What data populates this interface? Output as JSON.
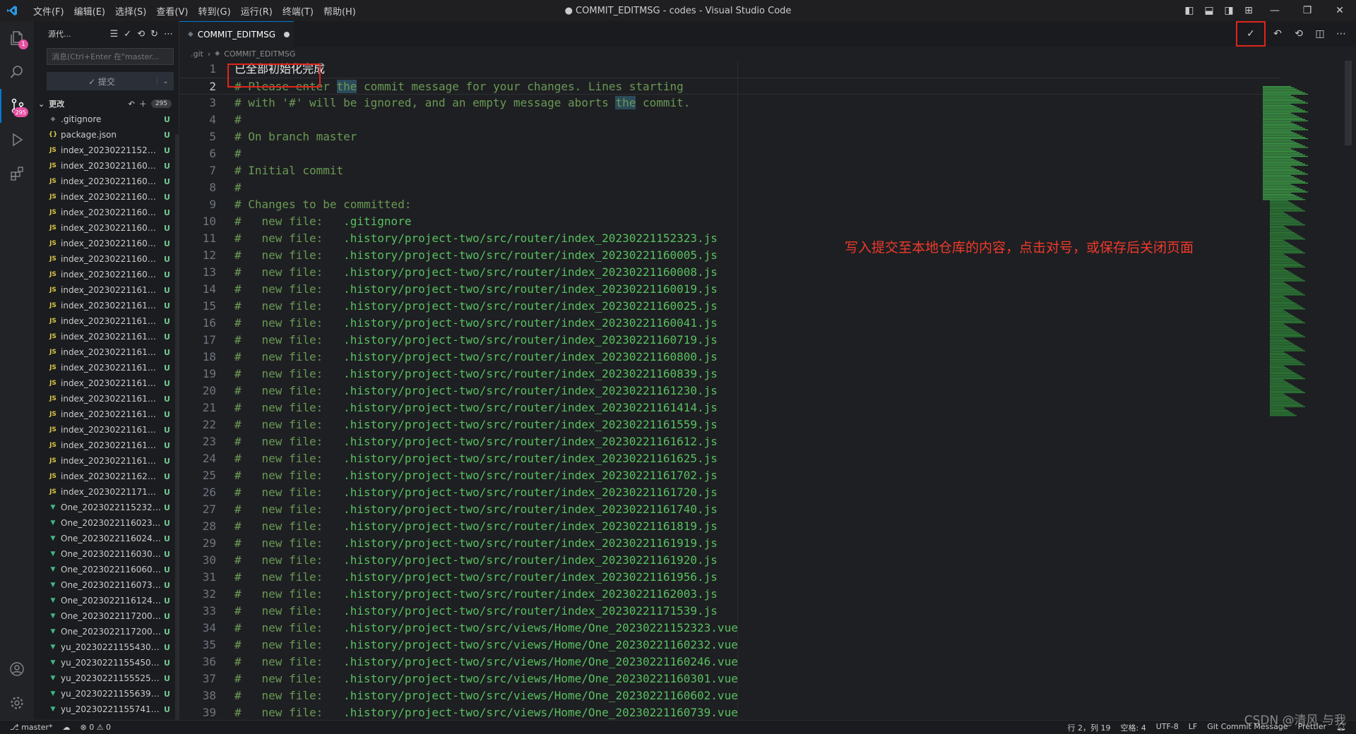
{
  "titlebar": {
    "menu": [
      "文件(F)",
      "编辑(E)",
      "选择(S)",
      "查看(V)",
      "转到(G)",
      "运行(R)",
      "终端(T)",
      "帮助(H)"
    ],
    "window_title": "● COMMIT_EDITMSG - codes - Visual Studio Code"
  },
  "activity": {
    "badge": "1"
  },
  "sidebar": {
    "title": "源代...",
    "commit_placeholder": "消息(Ctrl+Enter 在\"master...",
    "commit_button": "✓ 提交",
    "changes_label": "更改",
    "changes_count": "295",
    "files": [
      {
        "icon": "◆",
        "type": "git",
        "name": ".gitignore",
        "status": "U"
      },
      {
        "icon": "{}",
        "type": "json",
        "name": "package.json",
        "status": "U"
      },
      {
        "icon": "JS",
        "type": "js",
        "name": "index_2023022115232...",
        "status": "U"
      },
      {
        "icon": "JS",
        "type": "js",
        "name": "index_20230221160000...",
        "status": "U"
      },
      {
        "icon": "JS",
        "type": "js",
        "name": "index_20230221160000...",
        "status": "U"
      },
      {
        "icon": "JS",
        "type": "js",
        "name": "index_20230221160001...",
        "status": "U"
      },
      {
        "icon": "JS",
        "type": "js",
        "name": "index_20230221160002...",
        "status": "U"
      },
      {
        "icon": "JS",
        "type": "js",
        "name": "index_20230221160004...",
        "status": "U"
      },
      {
        "icon": "JS",
        "type": "js",
        "name": "index_2023022116071...",
        "status": "U"
      },
      {
        "icon": "JS",
        "type": "js",
        "name": "index_2023022116080...",
        "status": "U"
      },
      {
        "icon": "JS",
        "type": "js",
        "name": "index_2023022116083...",
        "status": "U"
      },
      {
        "icon": "JS",
        "type": "js",
        "name": "index_2023022116123...",
        "status": "U"
      },
      {
        "icon": "JS",
        "type": "js",
        "name": "index_2023022116141...",
        "status": "U"
      },
      {
        "icon": "JS",
        "type": "js",
        "name": "index_2023022116155...",
        "status": "U"
      },
      {
        "icon": "JS",
        "type": "js",
        "name": "index_2023022116161...",
        "status": "U"
      },
      {
        "icon": "JS",
        "type": "js",
        "name": "index_2023022116162...",
        "status": "U"
      },
      {
        "icon": "JS",
        "type": "js",
        "name": "index_2023022116170...",
        "status": "U"
      },
      {
        "icon": "JS",
        "type": "js",
        "name": "index_2023022116172...",
        "status": "U"
      },
      {
        "icon": "JS",
        "type": "js",
        "name": "index_2023022116174...",
        "status": "U"
      },
      {
        "icon": "JS",
        "type": "js",
        "name": "index_2023022116181...",
        "status": "U"
      },
      {
        "icon": "JS",
        "type": "js",
        "name": "index_2023022116191...",
        "status": "U"
      },
      {
        "icon": "JS",
        "type": "js",
        "name": "index_2023022116192...",
        "status": "U"
      },
      {
        "icon": "JS",
        "type": "js",
        "name": "index_2023022116195...",
        "status": "U"
      },
      {
        "icon": "JS",
        "type": "js",
        "name": "index_2023022116200...",
        "status": "U"
      },
      {
        "icon": "JS",
        "type": "js",
        "name": "index_2023022117153...",
        "status": "U"
      },
      {
        "icon": "▼",
        "type": "vue",
        "name": "One_20230221152323...",
        "status": "U"
      },
      {
        "icon": "▼",
        "type": "vue",
        "name": "One_2023022116023...",
        "status": "U"
      },
      {
        "icon": "▼",
        "type": "vue",
        "name": "One_20230221160246...",
        "status": "U"
      },
      {
        "icon": "▼",
        "type": "vue",
        "name": "One_20230221160301...",
        "status": "U"
      },
      {
        "icon": "▼",
        "type": "vue",
        "name": "One_20230221160602...",
        "status": "U"
      },
      {
        "icon": "▼",
        "type": "vue",
        "name": "One_20230221160739...",
        "status": "U"
      },
      {
        "icon": "▼",
        "type": "vue",
        "name": "One_20230221161242...",
        "status": "U"
      },
      {
        "icon": "▼",
        "type": "vue",
        "name": "One_20230221172001...",
        "status": "U"
      },
      {
        "icon": "▼",
        "type": "vue",
        "name": "One_20230221172003...",
        "status": "U"
      },
      {
        "icon": "▼",
        "type": "vue",
        "name": "yu_20230221155430.v...",
        "status": "U"
      },
      {
        "icon": "▼",
        "type": "vue",
        "name": "yu_20230221155450.v...",
        "status": "U"
      },
      {
        "icon": "▼",
        "type": "vue",
        "name": "yu_20230221155525.v...",
        "status": "U"
      },
      {
        "icon": "▼",
        "type": "vue",
        "name": "yu_20230221155639.v...",
        "status": "U"
      },
      {
        "icon": "▼",
        "type": "vue",
        "name": "yu_20230221155741.v...",
        "status": "U"
      }
    ]
  },
  "editor": {
    "tab_label": "COMMIT_EDITMSG",
    "breadcrumb": [
      ".git",
      "COMMIT_EDITMSG"
    ],
    "cursor_line": 2,
    "lines": [
      {
        "n": 1,
        "text": "已全部初始化完成",
        "kind": "plain"
      },
      {
        "n": 2,
        "text": "# Please enter the commit message for your changes. Lines starting",
        "kind": "comment"
      },
      {
        "n": 3,
        "text": "# with '#' will be ignored, and an empty message aborts the commit.",
        "kind": "comment"
      },
      {
        "n": 4,
        "text": "#",
        "kind": "comment"
      },
      {
        "n": 5,
        "text": "# On branch master",
        "kind": "comment"
      },
      {
        "n": 6,
        "text": "#",
        "kind": "comment"
      },
      {
        "n": 7,
        "text": "# Initial commit",
        "kind": "comment"
      },
      {
        "n": 8,
        "text": "#",
        "kind": "comment"
      },
      {
        "n": 9,
        "text": "# Changes to be committed:",
        "kind": "comment"
      },
      {
        "n": 10,
        "text": ".gitignore",
        "kind": "file"
      },
      {
        "n": 11,
        "text": ".history/project-two/src/router/index_20230221152323.js",
        "kind": "file"
      },
      {
        "n": 12,
        "text": ".history/project-two/src/router/index_20230221160005.js",
        "kind": "file"
      },
      {
        "n": 13,
        "text": ".history/project-two/src/router/index_20230221160008.js",
        "kind": "file"
      },
      {
        "n": 14,
        "text": ".history/project-two/src/router/index_20230221160019.js",
        "kind": "file"
      },
      {
        "n": 15,
        "text": ".history/project-two/src/router/index_20230221160025.js",
        "kind": "file"
      },
      {
        "n": 16,
        "text": ".history/project-two/src/router/index_20230221160041.js",
        "kind": "file"
      },
      {
        "n": 17,
        "text": ".history/project-two/src/router/index_20230221160719.js",
        "kind": "file"
      },
      {
        "n": 18,
        "text": ".history/project-two/src/router/index_20230221160800.js",
        "kind": "file"
      },
      {
        "n": 19,
        "text": ".history/project-two/src/router/index_20230221160839.js",
        "kind": "file"
      },
      {
        "n": 20,
        "text": ".history/project-two/src/router/index_20230221161230.js",
        "kind": "file"
      },
      {
        "n": 21,
        "text": ".history/project-two/src/router/index_20230221161414.js",
        "kind": "file"
      },
      {
        "n": 22,
        "text": ".history/project-two/src/router/index_20230221161559.js",
        "kind": "file"
      },
      {
        "n": 23,
        "text": ".history/project-two/src/router/index_20230221161612.js",
        "kind": "file"
      },
      {
        "n": 24,
        "text": ".history/project-two/src/router/index_20230221161625.js",
        "kind": "file"
      },
      {
        "n": 25,
        "text": ".history/project-two/src/router/index_20230221161702.js",
        "kind": "file"
      },
      {
        "n": 26,
        "text": ".history/project-two/src/router/index_20230221161720.js",
        "kind": "file"
      },
      {
        "n": 27,
        "text": ".history/project-two/src/router/index_20230221161740.js",
        "kind": "file"
      },
      {
        "n": 28,
        "text": ".history/project-two/src/router/index_20230221161819.js",
        "kind": "file"
      },
      {
        "n": 29,
        "text": ".history/project-two/src/router/index_20230221161919.js",
        "kind": "file"
      },
      {
        "n": 30,
        "text": ".history/project-two/src/router/index_20230221161920.js",
        "kind": "file"
      },
      {
        "n": 31,
        "text": ".history/project-two/src/router/index_20230221161956.js",
        "kind": "file"
      },
      {
        "n": 32,
        "text": ".history/project-two/src/router/index_20230221162003.js",
        "kind": "file"
      },
      {
        "n": 33,
        "text": ".history/project-two/src/router/index_20230221171539.js",
        "kind": "file"
      },
      {
        "n": 34,
        "text": ".history/project-two/src/views/Home/One_20230221152323.vue",
        "kind": "file"
      },
      {
        "n": 35,
        "text": ".history/project-two/src/views/Home/One_20230221160232.vue",
        "kind": "file"
      },
      {
        "n": 36,
        "text": ".history/project-two/src/views/Home/One_20230221160246.vue",
        "kind": "file"
      },
      {
        "n": 37,
        "text": ".history/project-two/src/views/Home/One_20230221160301.vue",
        "kind": "file"
      },
      {
        "n": 38,
        "text": ".history/project-two/src/views/Home/One_20230221160602.vue",
        "kind": "file"
      },
      {
        "n": 39,
        "text": ".history/project-two/src/views/Home/One_20230221160739.vue",
        "kind": "file"
      }
    ],
    "new_file_prefix": "#   new file:   ",
    "annotation": "写入提交至本地仓库的内容，点击对号，或保存后关闭页面"
  },
  "statusbar": {
    "branch": "master*",
    "problems": "⊗ 0 ⚠ 0",
    "position": "行 2，列 19",
    "spaces": "空格: 4",
    "encoding": "UTF-8",
    "eol": "LF",
    "language": "Git Commit Message",
    "formatter": "Prettier"
  },
  "watermark": "CSDN @清风 与我",
  "colors": {
    "accent": "#0078d4",
    "annotation_red": "#e0241b",
    "file_green": "#58c060",
    "comment_green": "#6a9955"
  }
}
